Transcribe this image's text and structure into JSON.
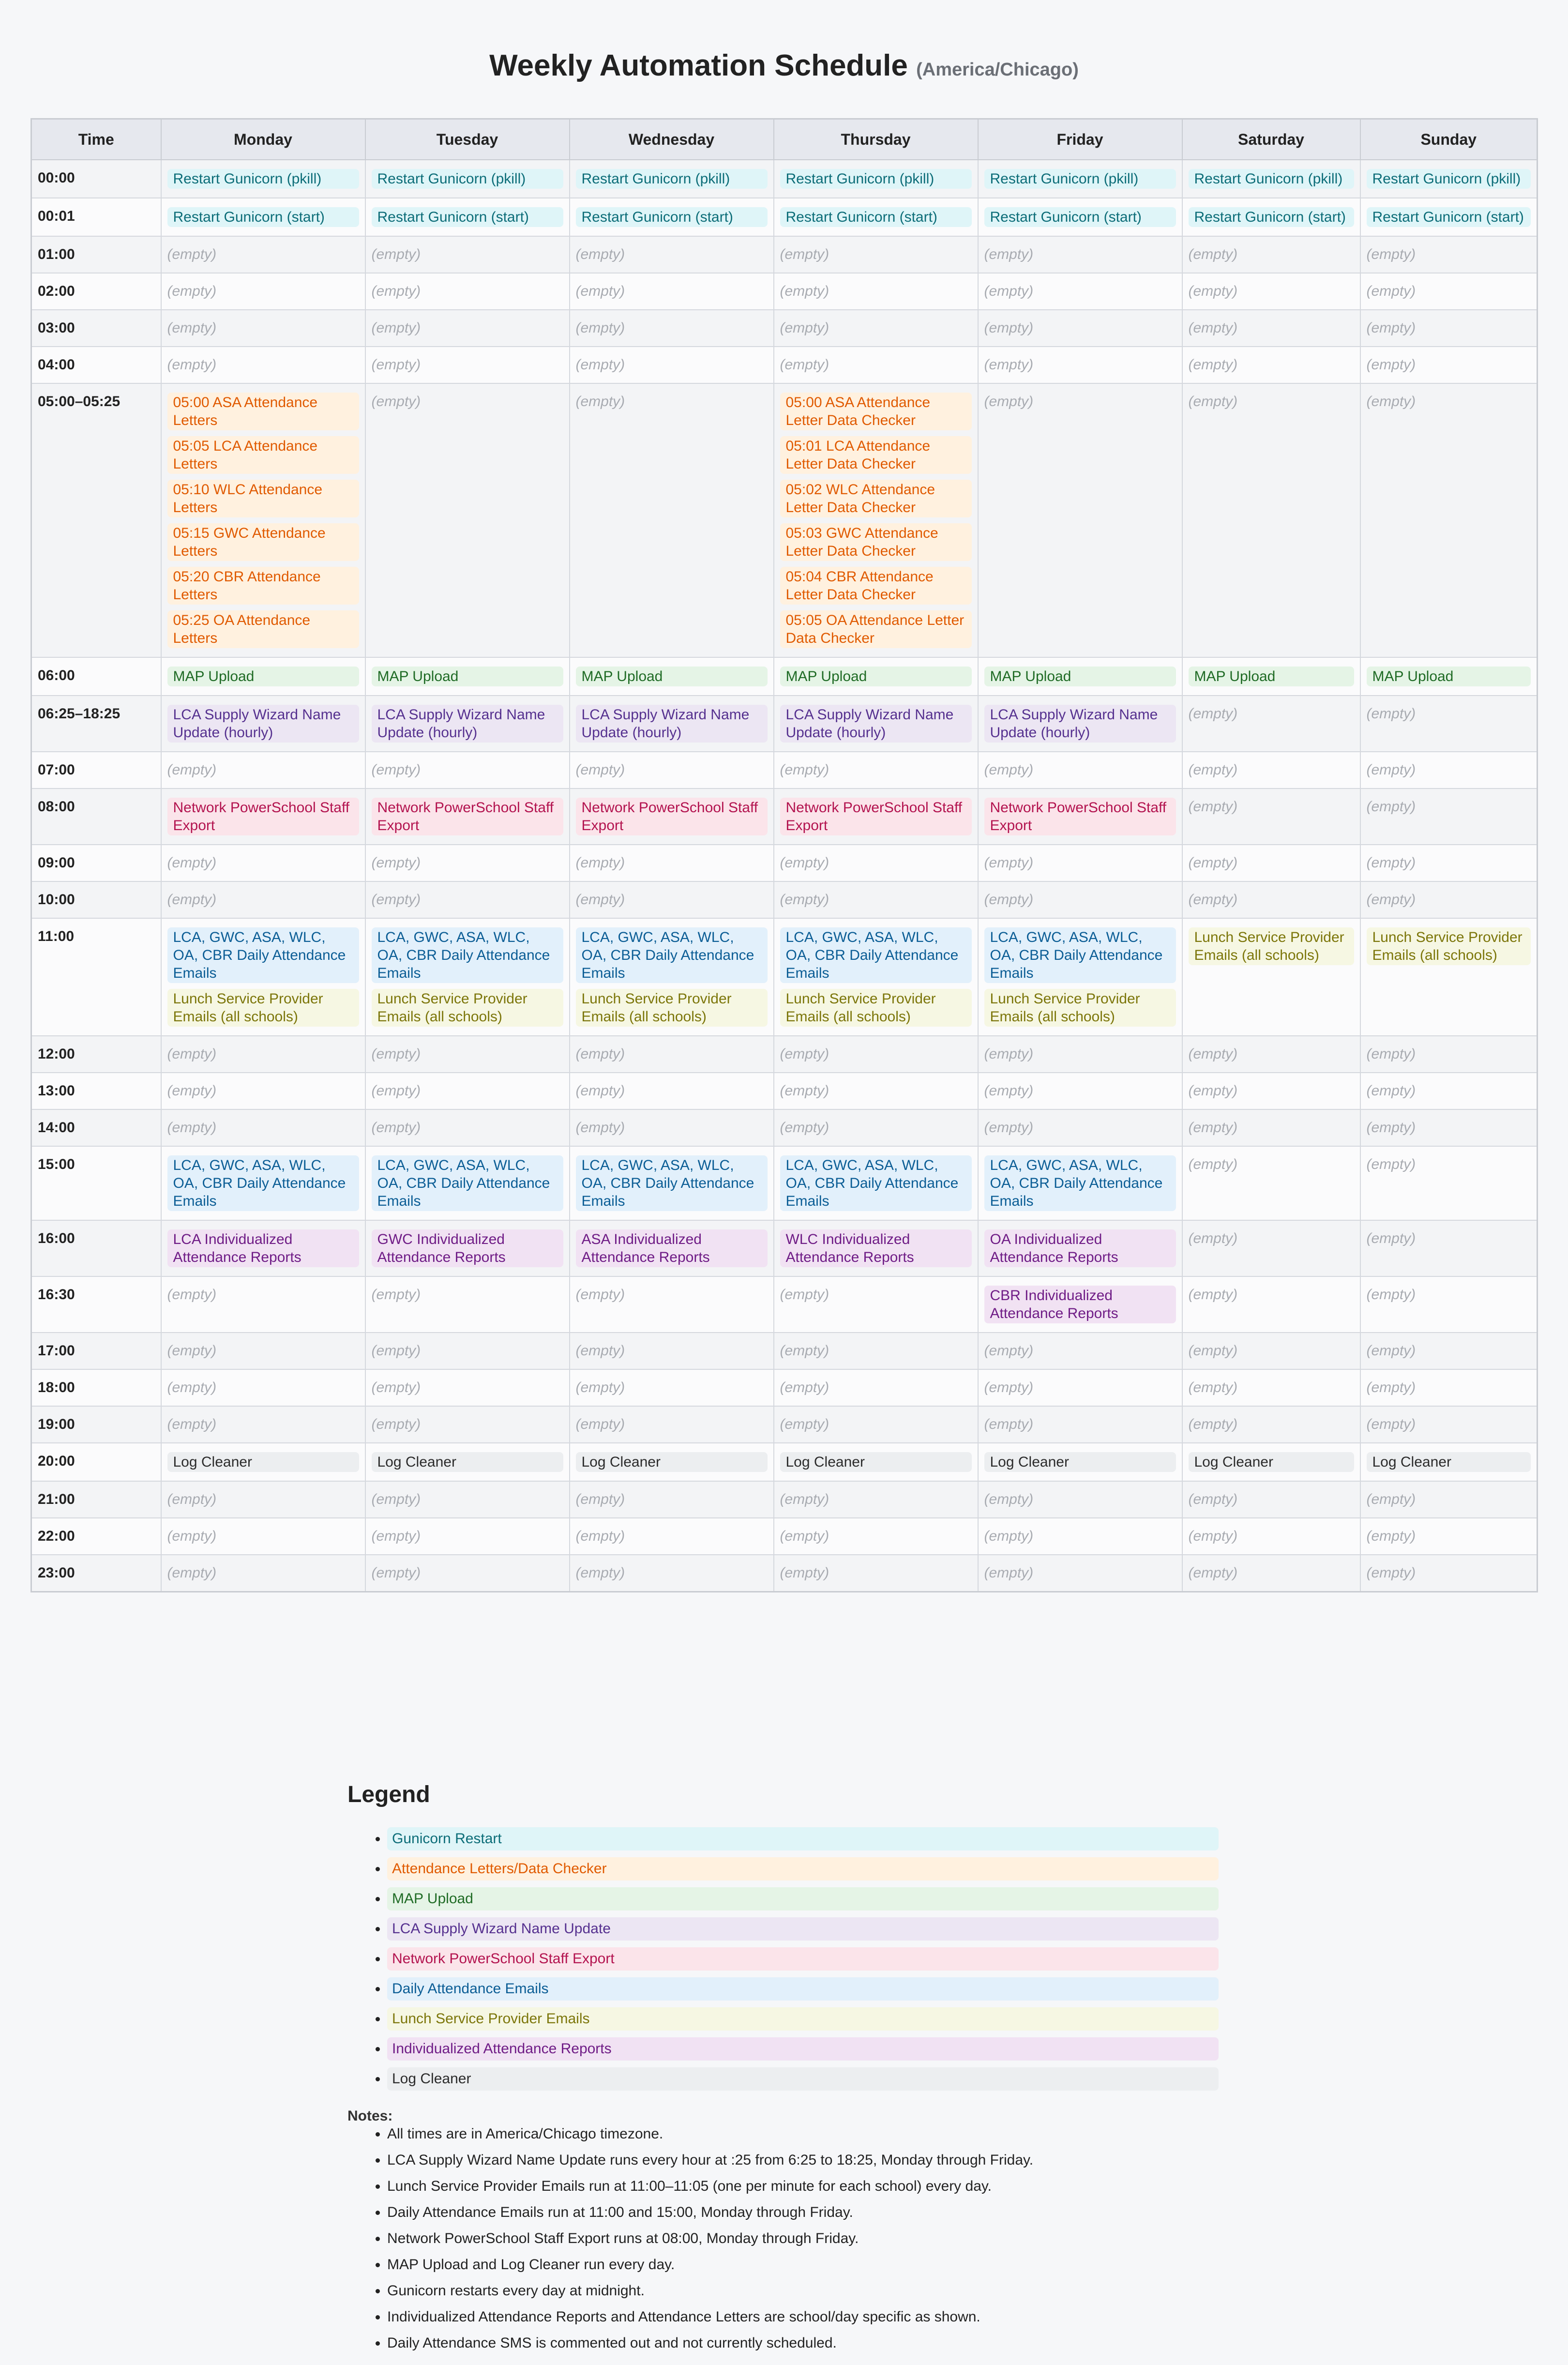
{
  "title": "Weekly Automation Schedule",
  "timezone_label": "(America/Chicago)",
  "columns": [
    "Time",
    "Monday",
    "Tuesday",
    "Wednesday",
    "Thursday",
    "Friday",
    "Saturday",
    "Sunday"
  ],
  "empty_label": "(empty)",
  "rows": [
    {
      "time": "00:00",
      "cells": [
        [
          {
            "c": "gunicorn",
            "t": "Restart Gunicorn (pkill)"
          }
        ],
        [
          {
            "c": "gunicorn",
            "t": "Restart Gunicorn (pkill)"
          }
        ],
        [
          {
            "c": "gunicorn",
            "t": "Restart Gunicorn (pkill)"
          }
        ],
        [
          {
            "c": "gunicorn",
            "t": "Restart Gunicorn (pkill)"
          }
        ],
        [
          {
            "c": "gunicorn",
            "t": "Restart Gunicorn (pkill)"
          }
        ],
        [
          {
            "c": "gunicorn",
            "t": "Restart Gunicorn (pkill)"
          }
        ],
        [
          {
            "c": "gunicorn",
            "t": "Restart Gunicorn (pkill)"
          }
        ]
      ]
    },
    {
      "time": "00:01",
      "cells": [
        [
          {
            "c": "gunicorn",
            "t": "Restart Gunicorn (start)"
          }
        ],
        [
          {
            "c": "gunicorn",
            "t": "Restart Gunicorn (start)"
          }
        ],
        [
          {
            "c": "gunicorn",
            "t": "Restart Gunicorn (start)"
          }
        ],
        [
          {
            "c": "gunicorn",
            "t": "Restart Gunicorn (start)"
          }
        ],
        [
          {
            "c": "gunicorn",
            "t": "Restart Gunicorn (start)"
          }
        ],
        [
          {
            "c": "gunicorn",
            "t": "Restart Gunicorn (start)"
          }
        ],
        [
          {
            "c": "gunicorn",
            "t": "Restart Gunicorn (start)"
          }
        ]
      ]
    },
    {
      "time": "01:00",
      "cells": [
        [],
        [],
        [],
        [],
        [],
        [],
        []
      ]
    },
    {
      "time": "02:00",
      "cells": [
        [],
        [],
        [],
        [],
        [],
        [],
        []
      ]
    },
    {
      "time": "03:00",
      "cells": [
        [],
        [],
        [],
        [],
        [],
        [],
        []
      ]
    },
    {
      "time": "04:00",
      "cells": [
        [],
        [],
        [],
        [],
        [],
        [],
        []
      ]
    },
    {
      "time": "05:00–05:25",
      "cells": [
        [
          {
            "c": "letters",
            "t": "05:00 ASA Attendance Letters"
          },
          {
            "c": "letters",
            "t": "05:05 LCA Attendance Letters"
          },
          {
            "c": "letters",
            "t": "05:10 WLC Attendance Letters"
          },
          {
            "c": "letters",
            "t": "05:15 GWC Attendance Letters"
          },
          {
            "c": "letters",
            "t": "05:20 CBR Attendance Letters"
          },
          {
            "c": "letters",
            "t": "05:25 OA Attendance Letters"
          }
        ],
        [],
        [],
        [
          {
            "c": "letters",
            "t": "05:00 ASA Attendance Letter Data Checker"
          },
          {
            "c": "letters",
            "t": "05:01 LCA Attendance Letter Data Checker"
          },
          {
            "c": "letters",
            "t": "05:02 WLC Attendance Letter Data Checker"
          },
          {
            "c": "letters",
            "t": "05:03 GWC Attendance Letter Data Checker"
          },
          {
            "c": "letters",
            "t": "05:04 CBR Attendance Letter Data Checker"
          },
          {
            "c": "letters",
            "t": "05:05 OA Attendance Letter Data Checker"
          }
        ],
        [],
        [],
        []
      ]
    },
    {
      "time": "06:00",
      "cells": [
        [
          {
            "c": "map",
            "t": "MAP Upload"
          }
        ],
        [
          {
            "c": "map",
            "t": "MAP Upload"
          }
        ],
        [
          {
            "c": "map",
            "t": "MAP Upload"
          }
        ],
        [
          {
            "c": "map",
            "t": "MAP Upload"
          }
        ],
        [
          {
            "c": "map",
            "t": "MAP Upload"
          }
        ],
        [
          {
            "c": "map",
            "t": "MAP Upload"
          }
        ],
        [
          {
            "c": "map",
            "t": "MAP Upload"
          }
        ]
      ]
    },
    {
      "time": "06:25–18:25",
      "cells": [
        [
          {
            "c": "lca",
            "t": "LCA Supply Wizard Name Update (hourly)"
          }
        ],
        [
          {
            "c": "lca",
            "t": "LCA Supply Wizard Name Update (hourly)"
          }
        ],
        [
          {
            "c": "lca",
            "t": "LCA Supply Wizard Name Update (hourly)"
          }
        ],
        [
          {
            "c": "lca",
            "t": "LCA Supply Wizard Name Update (hourly)"
          }
        ],
        [
          {
            "c": "lca",
            "t": "LCA Supply Wizard Name Update (hourly)"
          }
        ],
        [],
        []
      ]
    },
    {
      "time": "07:00",
      "cells": [
        [],
        [],
        [],
        [],
        [],
        [],
        []
      ]
    },
    {
      "time": "08:00",
      "cells": [
        [
          {
            "c": "nps",
            "t": "Network PowerSchool Staff Export"
          }
        ],
        [
          {
            "c": "nps",
            "t": "Network PowerSchool Staff Export"
          }
        ],
        [
          {
            "c": "nps",
            "t": "Network PowerSchool Staff Export"
          }
        ],
        [
          {
            "c": "nps",
            "t": "Network PowerSchool Staff Export"
          }
        ],
        [
          {
            "c": "nps",
            "t": "Network PowerSchool Staff Export"
          }
        ],
        [],
        []
      ]
    },
    {
      "time": "09:00",
      "cells": [
        [],
        [],
        [],
        [],
        [],
        [],
        []
      ]
    },
    {
      "time": "10:00",
      "cells": [
        [],
        [],
        [],
        [],
        [],
        [],
        []
      ]
    },
    {
      "time": "11:00",
      "cells": [
        [
          {
            "c": "daily",
            "t": "LCA, GWC, ASA, WLC, OA, CBR Daily Attendance Emails"
          },
          {
            "c": "lunch",
            "t": "Lunch Service Provider Emails (all schools)"
          }
        ],
        [
          {
            "c": "daily",
            "t": "LCA, GWC, ASA, WLC, OA, CBR Daily Attendance Emails"
          },
          {
            "c": "lunch",
            "t": "Lunch Service Provider Emails (all schools)"
          }
        ],
        [
          {
            "c": "daily",
            "t": "LCA, GWC, ASA, WLC, OA, CBR Daily Attendance Emails"
          },
          {
            "c": "lunch",
            "t": "Lunch Service Provider Emails (all schools)"
          }
        ],
        [
          {
            "c": "daily",
            "t": "LCA, GWC, ASA, WLC, OA, CBR Daily Attendance Emails"
          },
          {
            "c": "lunch",
            "t": "Lunch Service Provider Emails (all schools)"
          }
        ],
        [
          {
            "c": "daily",
            "t": "LCA, GWC, ASA, WLC, OA, CBR Daily Attendance Emails"
          },
          {
            "c": "lunch",
            "t": "Lunch Service Provider Emails (all schools)"
          }
        ],
        [
          {
            "c": "lunch",
            "t": "Lunch Service Provider Emails (all schools)"
          }
        ],
        [
          {
            "c": "lunch",
            "t": "Lunch Service Provider Emails (all schools)"
          }
        ]
      ]
    },
    {
      "time": "12:00",
      "cells": [
        [],
        [],
        [],
        [],
        [],
        [],
        []
      ]
    },
    {
      "time": "13:00",
      "cells": [
        [],
        [],
        [],
        [],
        [],
        [],
        []
      ]
    },
    {
      "time": "14:00",
      "cells": [
        [],
        [],
        [],
        [],
        [],
        [],
        []
      ]
    },
    {
      "time": "15:00",
      "cells": [
        [
          {
            "c": "daily",
            "t": "LCA, GWC, ASA, WLC, OA, CBR Daily Attendance Emails"
          }
        ],
        [
          {
            "c": "daily",
            "t": "LCA, GWC, ASA, WLC, OA, CBR Daily Attendance Emails"
          }
        ],
        [
          {
            "c": "daily",
            "t": "LCA, GWC, ASA, WLC, OA, CBR Daily Attendance Emails"
          }
        ],
        [
          {
            "c": "daily",
            "t": "LCA, GWC, ASA, WLC, OA, CBR Daily Attendance Emails"
          }
        ],
        [
          {
            "c": "daily",
            "t": "LCA, GWC, ASA, WLC, OA, CBR Daily Attendance Emails"
          }
        ],
        [],
        []
      ]
    },
    {
      "time": "16:00",
      "cells": [
        [
          {
            "c": "indiv",
            "t": "LCA Individualized Attendance Reports"
          }
        ],
        [
          {
            "c": "indiv",
            "t": "GWC Individualized Attendance Reports"
          }
        ],
        [
          {
            "c": "indiv",
            "t": "ASA Individualized Attendance Reports"
          }
        ],
        [
          {
            "c": "indiv",
            "t": "WLC Individualized Attendance Reports"
          }
        ],
        [
          {
            "c": "indiv",
            "t": "OA Individualized Attendance Reports"
          }
        ],
        [],
        []
      ]
    },
    {
      "time": "16:30",
      "cells": [
        [],
        [],
        [],
        [],
        [
          {
            "c": "indiv",
            "t": "CBR Individualized Attendance Reports"
          }
        ],
        [],
        []
      ]
    },
    {
      "time": "17:00",
      "cells": [
        [],
        [],
        [],
        [],
        [],
        [],
        []
      ]
    },
    {
      "time": "18:00",
      "cells": [
        [],
        [],
        [],
        [],
        [],
        [],
        []
      ]
    },
    {
      "time": "19:00",
      "cells": [
        [],
        [],
        [],
        [],
        [],
        [],
        []
      ]
    },
    {
      "time": "20:00",
      "cells": [
        [
          {
            "c": "log",
            "t": "Log Cleaner"
          }
        ],
        [
          {
            "c": "log",
            "t": "Log Cleaner"
          }
        ],
        [
          {
            "c": "log",
            "t": "Log Cleaner"
          }
        ],
        [
          {
            "c": "log",
            "t": "Log Cleaner"
          }
        ],
        [
          {
            "c": "log",
            "t": "Log Cleaner"
          }
        ],
        [
          {
            "c": "log",
            "t": "Log Cleaner"
          }
        ],
        [
          {
            "c": "log",
            "t": "Log Cleaner"
          }
        ]
      ]
    },
    {
      "time": "21:00",
      "cells": [
        [],
        [],
        [],
        [],
        [],
        [],
        []
      ]
    },
    {
      "time": "22:00",
      "cells": [
        [],
        [],
        [],
        [],
        [],
        [],
        []
      ]
    },
    {
      "time": "23:00",
      "cells": [
        [],
        [],
        [],
        [],
        [],
        [],
        []
      ]
    }
  ],
  "legend": {
    "title": "Legend",
    "items": [
      {
        "c": "gunicorn",
        "label": "Gunicorn Restart"
      },
      {
        "c": "letters",
        "label": "Attendance Letters/Data Checker"
      },
      {
        "c": "map",
        "label": "MAP Upload"
      },
      {
        "c": "lca",
        "label": "LCA Supply Wizard Name Update"
      },
      {
        "c": "nps",
        "label": "Network PowerSchool Staff Export"
      },
      {
        "c": "daily",
        "label": "Daily Attendance Emails"
      },
      {
        "c": "lunch",
        "label": "Lunch Service Provider Emails"
      },
      {
        "c": "indiv",
        "label": "Individualized Attendance Reports"
      },
      {
        "c": "log",
        "label": "Log Cleaner"
      }
    ]
  },
  "notes": {
    "title": "Notes:",
    "items": [
      "All times are in America/Chicago timezone.",
      "LCA Supply Wizard Name Update runs every hour at :25 from 6:25 to 18:25, Monday through Friday.",
      "Lunch Service Provider Emails run at 11:00–11:05 (one per minute for each school) every day.",
      "Daily Attendance Emails run at 11:00 and 15:00, Monday through Friday.",
      "Network PowerSchool Staff Export runs at 08:00, Monday through Friday.",
      "MAP Upload and Log Cleaner run every day.",
      "Gunicorn restarts every day at midnight.",
      "Individualized Attendance Reports and Attendance Letters are school/day specific as shown.",
      "Daily Attendance SMS is commented out and not currently scheduled."
    ]
  },
  "colors": {
    "gunicorn": "#0c6d78",
    "letters": "#e05a00",
    "map": "#1f6b25",
    "lca": "#55308f",
    "nps": "#b3134f",
    "daily": "#0b5d95",
    "lunch": "#7c760a",
    "indiv": "#6f1c86",
    "log": "#2b2b2b"
  }
}
